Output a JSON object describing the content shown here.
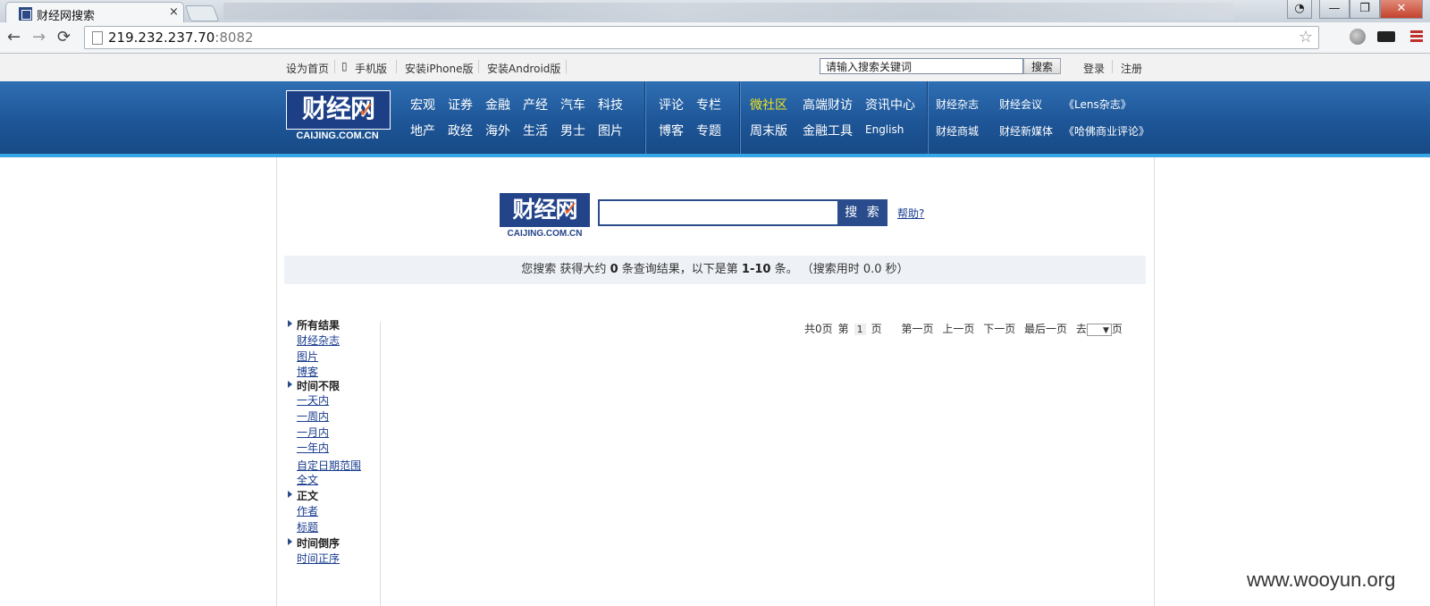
{
  "browser": {
    "tab_title": "财经网搜索",
    "tab_close": "×",
    "address_host": "219.232.237.70",
    "address_port": ":8082",
    "back": "←",
    "forward": "→",
    "reload": "⟳",
    "star": "☆",
    "win_min": "—",
    "win_max": "❐",
    "win_close": "✕"
  },
  "utility": {
    "set_home": "设为首页",
    "mobile": "手机版",
    "iphone": "安装iPhone版",
    "android": "安装Android版",
    "search_placeholder": "请输入搜索关键词",
    "search_btn": "搜索",
    "login": "登录",
    "register": "注册"
  },
  "header": {
    "logo": "财经网",
    "logo_sub": "CAIJING.COM.CN",
    "nav_a": [
      "宏观",
      "证券",
      "金融",
      "产经",
      "汽车",
      "科技",
      "地产",
      "政经",
      "海外",
      "生活",
      "男士",
      "图片"
    ],
    "nav_b": [
      "评论",
      "专栏",
      "博客",
      "专题"
    ],
    "nav_c": [
      "微社区",
      "高端财访",
      "资讯中心",
      "周末版",
      "金融工具",
      "English"
    ],
    "nav_d": [
      "财经杂志",
      "财经会议",
      "《Lens杂志》",
      "财经商城",
      "财经新媒体",
      "《哈佛商业评论》"
    ],
    "highlight_color": "#f3e51b"
  },
  "search": {
    "logo": "财经网",
    "logo_sub": "CAIJING.COM.CN",
    "button": "搜 索",
    "help": "帮助?",
    "result_pre": "您搜索 获得大约",
    "result_count": "0",
    "result_mid": "条查询结果，以下是第",
    "result_range": "1-10",
    "result_post": "条。 （搜索用时 0.0 秒）"
  },
  "pager": {
    "total": "共0页",
    "page_pre": "第",
    "current": "1",
    "page_post": "页",
    "first": "第一页",
    "prev": "上一页",
    "next": "下一页",
    "last": "最后一页",
    "goto": "去",
    "goto_post": "页",
    "select_arrow": "▼"
  },
  "sidebar": {
    "all_results": "所有结果",
    "magazine": "财经杂志",
    "pictures": "图片",
    "blog": "博客",
    "time_any": "时间不限",
    "day": "一天内",
    "week": "一周内",
    "month": "一月内",
    "year": "一年内",
    "custom_range": "自定日期范围",
    "fulltext": "全文",
    "body": "正文",
    "author": "作者",
    "title": "标题",
    "time_desc": "时间倒序",
    "time_asc": "时间正序"
  },
  "watermark": "www.wooyun.org"
}
